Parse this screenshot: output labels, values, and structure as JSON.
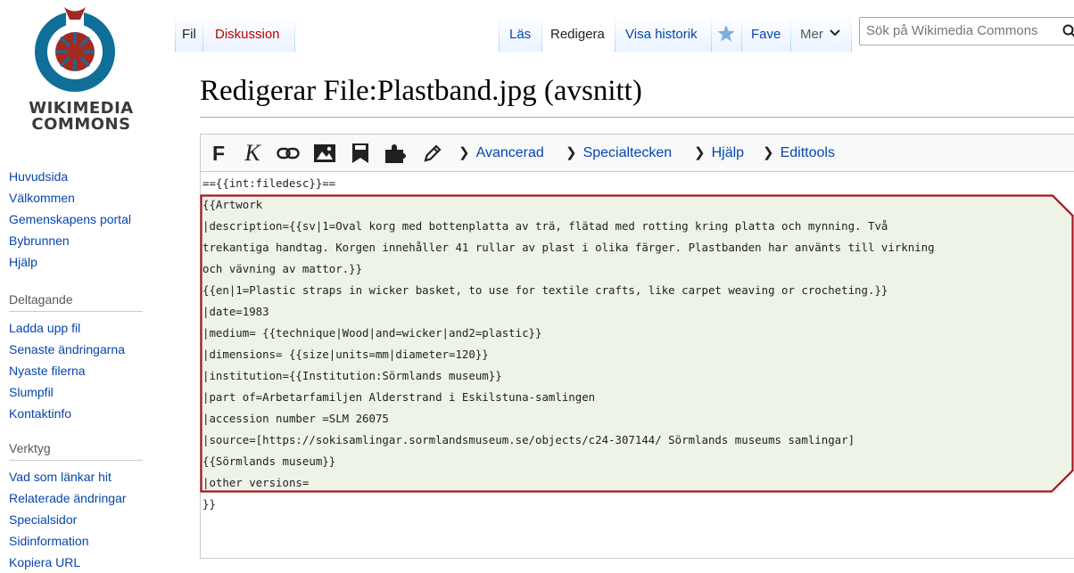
{
  "logo": {
    "line1": "WIKIMEDIA",
    "line2": "COMMONS"
  },
  "sidebar": {
    "main_links": [
      "Huvudsida",
      "Välkommen",
      "Gemenskapens portal",
      "Bybrunnen",
      "Hjälp"
    ],
    "participate": {
      "heading": "Deltagande",
      "links": [
        "Ladda upp fil",
        "Senaste ändringarna",
        "Nyaste filerna",
        "Slumpfil",
        "Kontaktinfo"
      ]
    },
    "tools": {
      "heading": "Verktyg",
      "links": [
        "Vad som länkar hit",
        "Relaterade ändringar",
        "Specialsidor",
        "Sidinformation",
        "Kopiera URL"
      ]
    }
  },
  "tabs": {
    "left": [
      "Fil",
      "Diskussion"
    ],
    "right": [
      "Läs",
      "Redigera",
      "Visa historik",
      "Fave",
      "Mer"
    ]
  },
  "search": {
    "placeholder": "Sök på Wikimedia Commons"
  },
  "page_title": "Redigerar File:Plastband.jpg (avsnitt)",
  "toolbar": {
    "bold": "F",
    "italic": "K",
    "links": [
      "Avancerad",
      "Specialtecken",
      "Hjälp",
      "Edittools"
    ]
  },
  "wikitext": [
    "=={{int:filedesc}}==",
    "{{Artwork",
    "|description={{sv|1=Oval korg med bottenplatta av trä, flätad med rotting kring platta och mynning. Två",
    "trekantiga handtag. Korgen innehåller 41 rullar av plast i olika färger. Plastbanden har använts till virkning",
    "och vävning av mattor.}}",
    "{{en|1=Plastic straps in wicker basket, to use for textile crafts, like carpet weaving or crocheting.}}",
    "|date=1983",
    "|medium= {{technique|Wood|and=wicker|and2=plastic}}",
    "|dimensions= {{size|units=mm|diameter=120}}",
    "|institution={{Institution:Sörmlands museum}}",
    "|part of=Arbetarfamiljen Alderstrand i Eskilstuna-samlingen",
    "|accession number =SLM 26075",
    "|source=[https://sokisamlingar.sormlandsmuseum.se/objects/c24-307144/ Sörmlands museums samlingar]",
    "{{Sörmlands museum}}",
    "|other versions=",
    "}}"
  ],
  "colors": {
    "highlight_fill": "#eef3e8",
    "highlight_border": "#a8151e",
    "link": "#0645ad"
  }
}
